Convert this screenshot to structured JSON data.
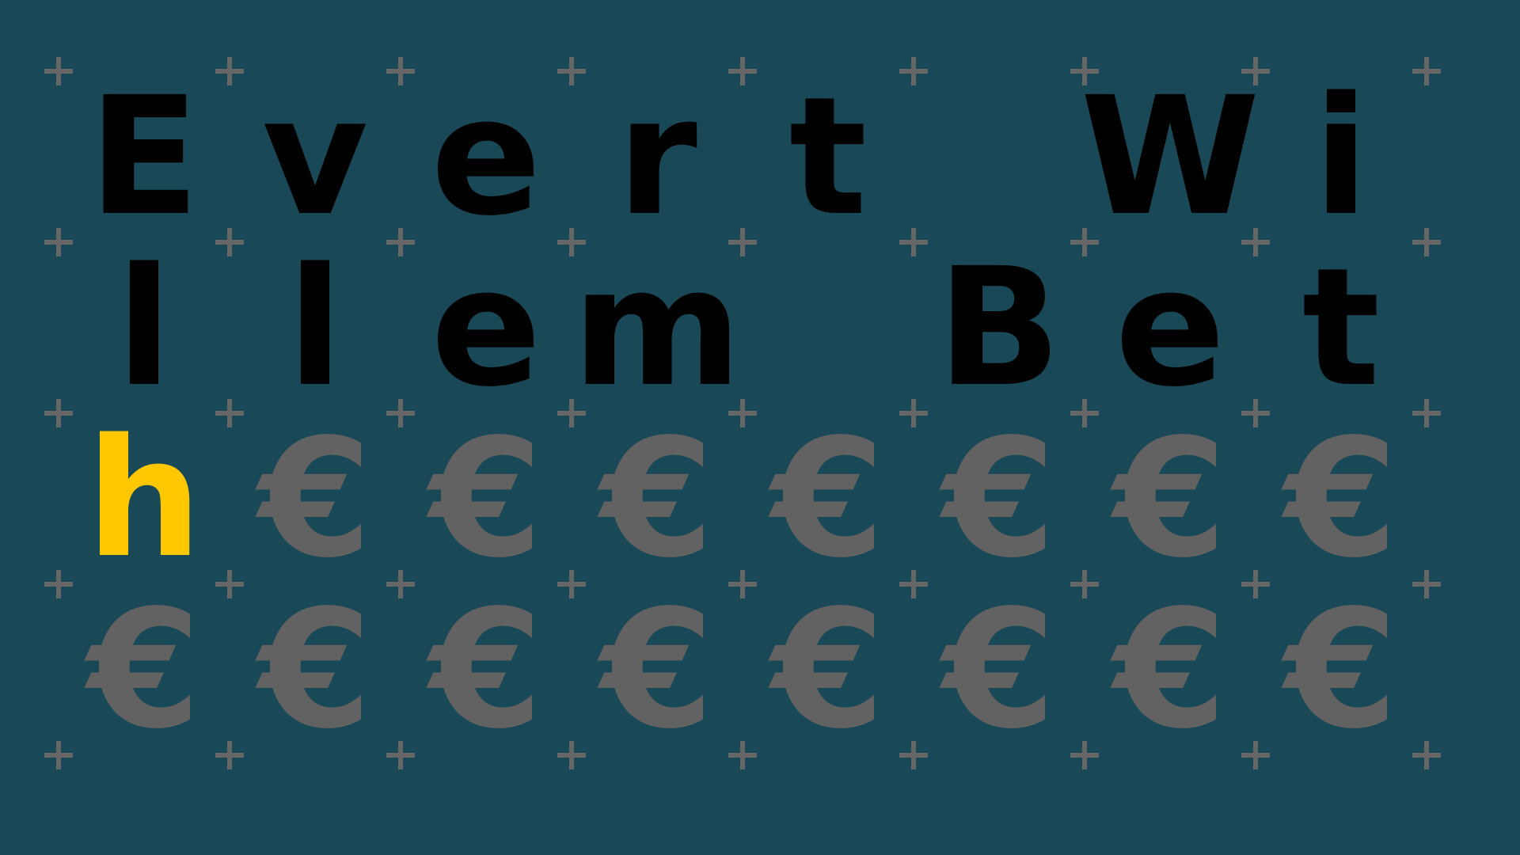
{
  "puzzle": {
    "grid": [
      [
        "E",
        "v",
        "e",
        "r",
        "t",
        " ",
        "W",
        "i"
      ],
      [
        "l",
        "l",
        "e",
        "m",
        " ",
        "B",
        "e",
        "t"
      ],
      [
        "h",
        "€",
        "€",
        "€",
        "€",
        "€",
        "€",
        "€"
      ],
      [
        "€",
        "€",
        "€",
        "€",
        "€",
        "€",
        "€",
        "€"
      ]
    ],
    "cell_states": [
      [
        "letter",
        "letter",
        "letter",
        "letter",
        "letter",
        "empty",
        "letter",
        "letter"
      ],
      [
        "letter",
        "letter",
        "letter",
        "letter",
        "empty",
        "letter",
        "letter",
        "letter"
      ],
      [
        "hint",
        "hidden",
        "hidden",
        "hidden",
        "hidden",
        "hidden",
        "hidden",
        "hidden"
      ],
      [
        "hidden",
        "hidden",
        "hidden",
        "hidden",
        "hidden",
        "hidden",
        "hidden",
        "hidden"
      ]
    ]
  },
  "colors": {
    "background": "#194857",
    "revealed_letter": "#000000",
    "hint_letter": "#ffc800",
    "hidden_symbol": "#626262",
    "grid_marker": "#676767"
  },
  "icons": {
    "grid_marker": "plus-icon",
    "hidden_cell": "euro-sign-icon"
  }
}
